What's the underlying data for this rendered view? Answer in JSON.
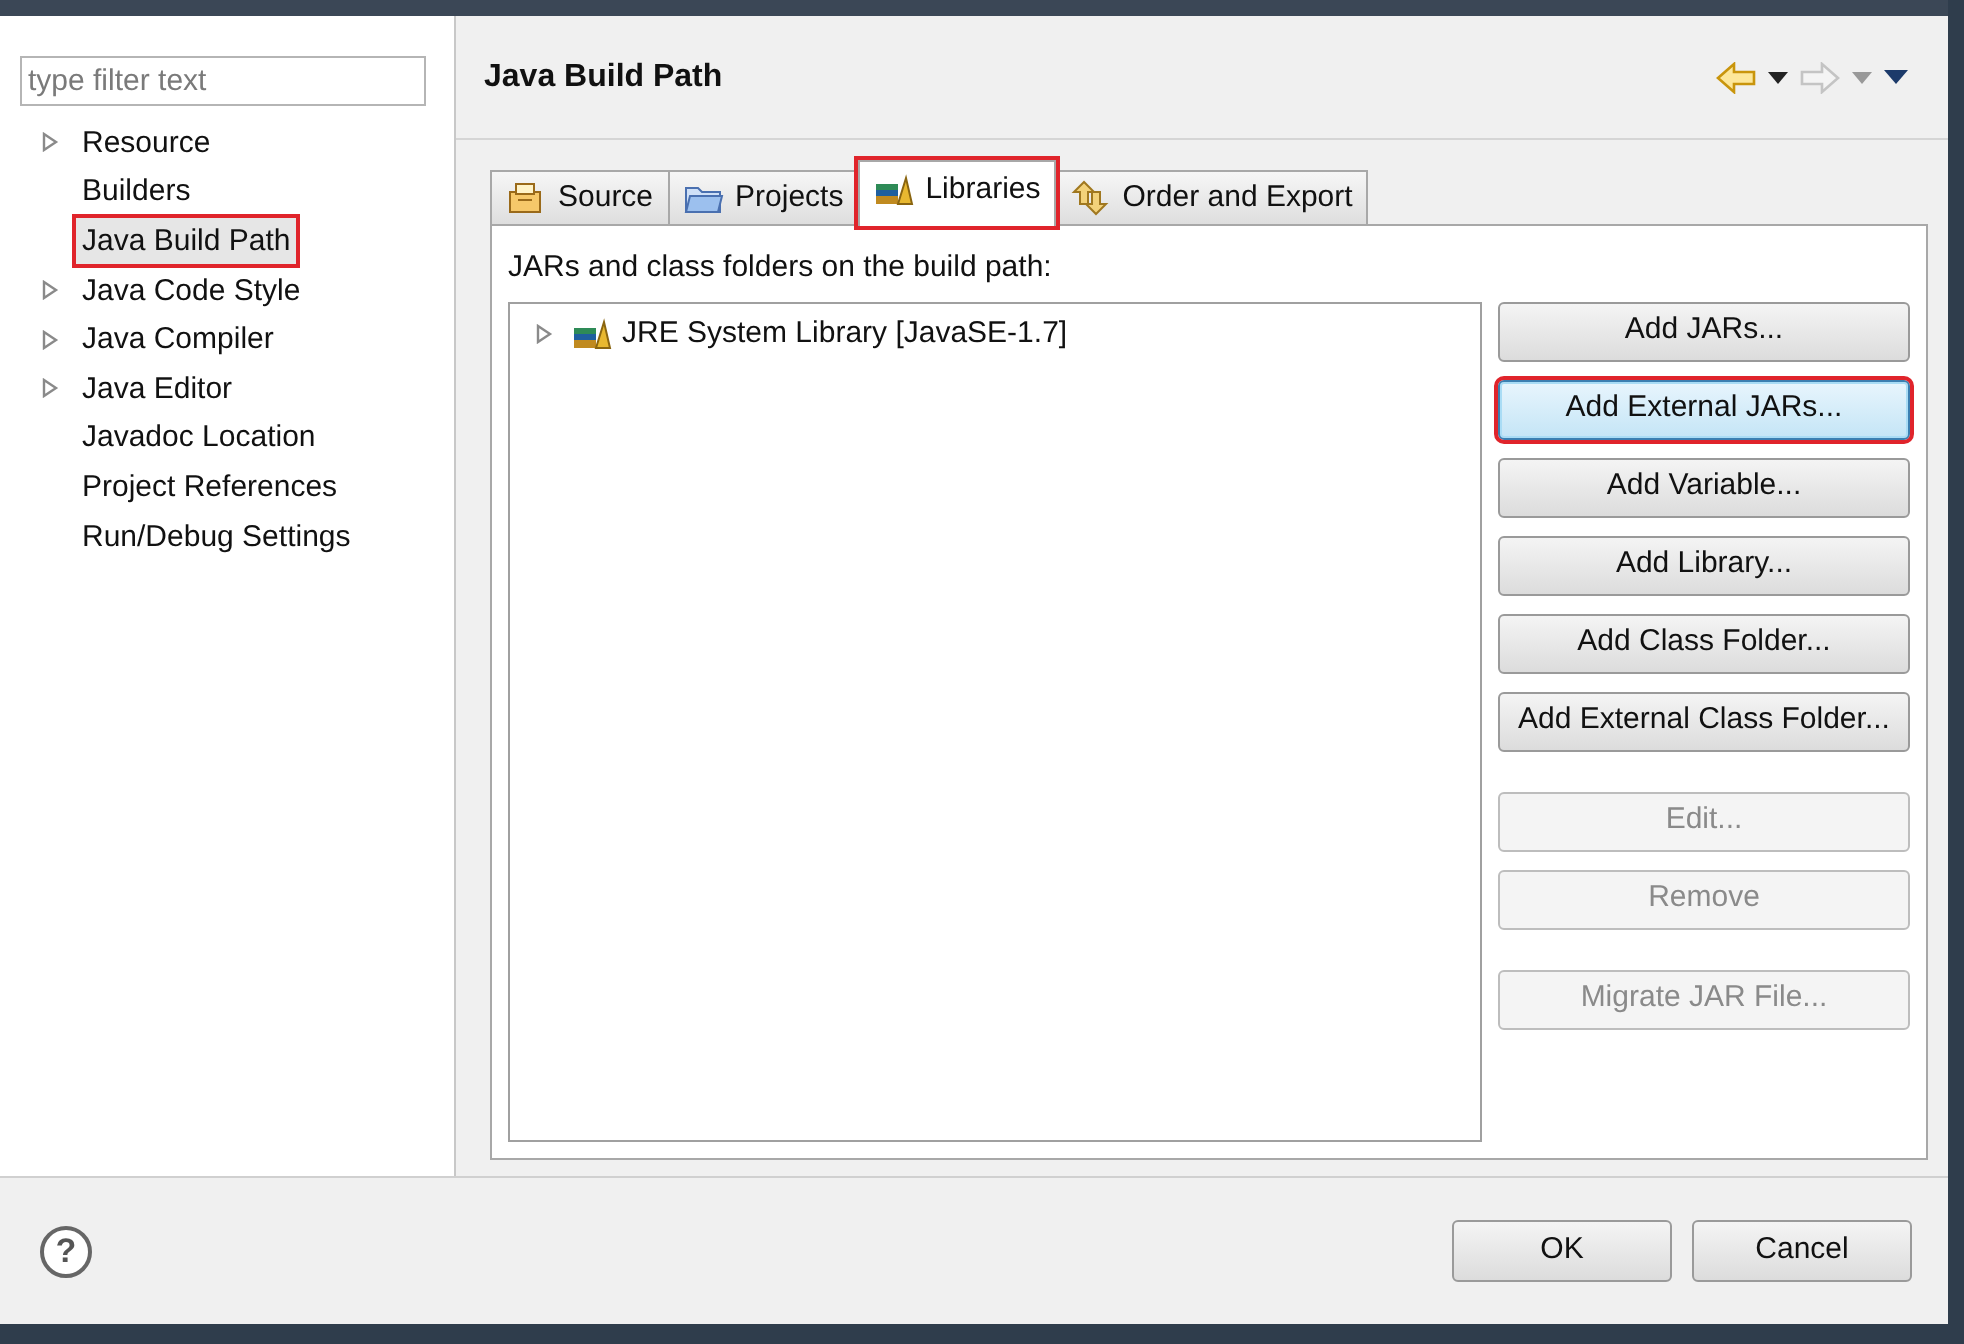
{
  "filter": {
    "placeholder": "type filter text"
  },
  "tree": [
    {
      "label": "Resource",
      "expandable": true,
      "selected": false,
      "highlighted": false
    },
    {
      "label": "Builders",
      "expandable": false,
      "selected": false,
      "highlighted": false
    },
    {
      "label": "Java Build Path",
      "expandable": false,
      "selected": true,
      "highlighted": true
    },
    {
      "label": "Java Code Style",
      "expandable": true,
      "selected": false,
      "highlighted": false
    },
    {
      "label": "Java Compiler",
      "expandable": true,
      "selected": false,
      "highlighted": false
    },
    {
      "label": "Java Editor",
      "expandable": true,
      "selected": false,
      "highlighted": false
    },
    {
      "label": "Javadoc Location",
      "expandable": false,
      "selected": false,
      "highlighted": false
    },
    {
      "label": "Project References",
      "expandable": false,
      "selected": false,
      "highlighted": false
    },
    {
      "label": "Run/Debug Settings",
      "expandable": false,
      "selected": false,
      "highlighted": false
    }
  ],
  "page": {
    "title": "Java Build Path"
  },
  "tabs": [
    {
      "label": "Source",
      "kind": "source",
      "selected": false,
      "highlighted": false
    },
    {
      "label": "Projects",
      "kind": "projects",
      "selected": false,
      "highlighted": false
    },
    {
      "label": "Libraries",
      "kind": "libraries",
      "selected": true,
      "highlighted": true
    },
    {
      "label": "Order and Export",
      "kind": "order",
      "selected": false,
      "highlighted": false
    }
  ],
  "list_label": "JARs and class folders on the build path:",
  "libraries": [
    {
      "label": "JRE System Library [JavaSE-1.7]",
      "expandable": true
    }
  ],
  "buttons": [
    {
      "label": "Add JARs...",
      "disabled": false,
      "focused": false,
      "highlighted": false,
      "gap_before": false
    },
    {
      "label": "Add External JARs...",
      "disabled": false,
      "focused": true,
      "highlighted": true,
      "gap_before": false
    },
    {
      "label": "Add Variable...",
      "disabled": false,
      "focused": false,
      "highlighted": false,
      "gap_before": false
    },
    {
      "label": "Add Library...",
      "disabled": false,
      "focused": false,
      "highlighted": false,
      "gap_before": false
    },
    {
      "label": "Add Class Folder...",
      "disabled": false,
      "focused": false,
      "highlighted": false,
      "gap_before": false
    },
    {
      "label": "Add External Class Folder...",
      "disabled": false,
      "focused": false,
      "highlighted": false,
      "gap_before": false
    },
    {
      "label": "Edit...",
      "disabled": true,
      "focused": false,
      "highlighted": false,
      "gap_before": true
    },
    {
      "label": "Remove",
      "disabled": true,
      "focused": false,
      "highlighted": false,
      "gap_before": false
    },
    {
      "label": "Migrate JAR File...",
      "disabled": true,
      "focused": false,
      "highlighted": false,
      "gap_before": true
    }
  ],
  "help": "?",
  "footer_buttons": [
    {
      "label": "OK"
    },
    {
      "label": "Cancel"
    }
  ]
}
